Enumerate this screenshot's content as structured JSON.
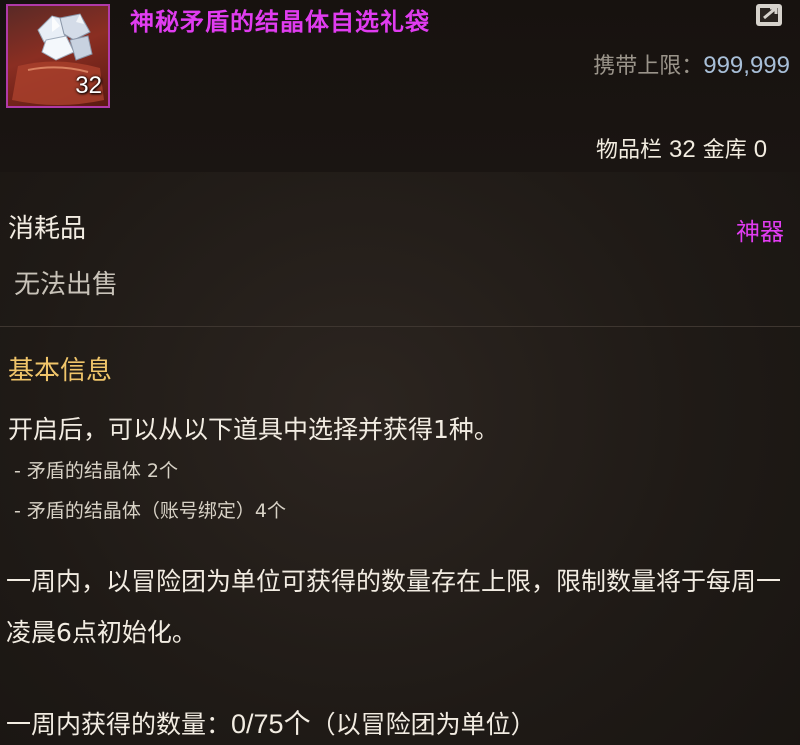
{
  "item": {
    "name": "神秘矛盾的结晶体自选礼袋",
    "count": "32",
    "icon": "crystal-bag-icon",
    "rarity": "神器",
    "rarity_color": "#e03cf0"
  },
  "carry_limit": {
    "label": "携带上限：",
    "value": "999,999"
  },
  "storage": {
    "inventory_label": "物品栏",
    "inventory_count": "32",
    "bank_label": "金库",
    "bank_count": "0"
  },
  "category": "消耗品",
  "sell_status": "无法出售",
  "basic_info": {
    "title": "基本信息",
    "title_color": "#f0c56a",
    "description": "开启后，可以从以下道具中选择并获得1种。",
    "options": [
      "- 矛盾的结晶体 2个",
      "- 矛盾的结晶体（账号绑定）4个"
    ]
  },
  "weekly": {
    "limit_text": "一周内，以冒险团为单位可获得的数量存在上限，限制数量将于每周一凌晨6点初始化。",
    "count_label": "一周内获得的数量：",
    "count_value": "0/75个",
    "count_suffix": "（以冒险团为单位）"
  },
  "link_icon": "share-link-icon"
}
